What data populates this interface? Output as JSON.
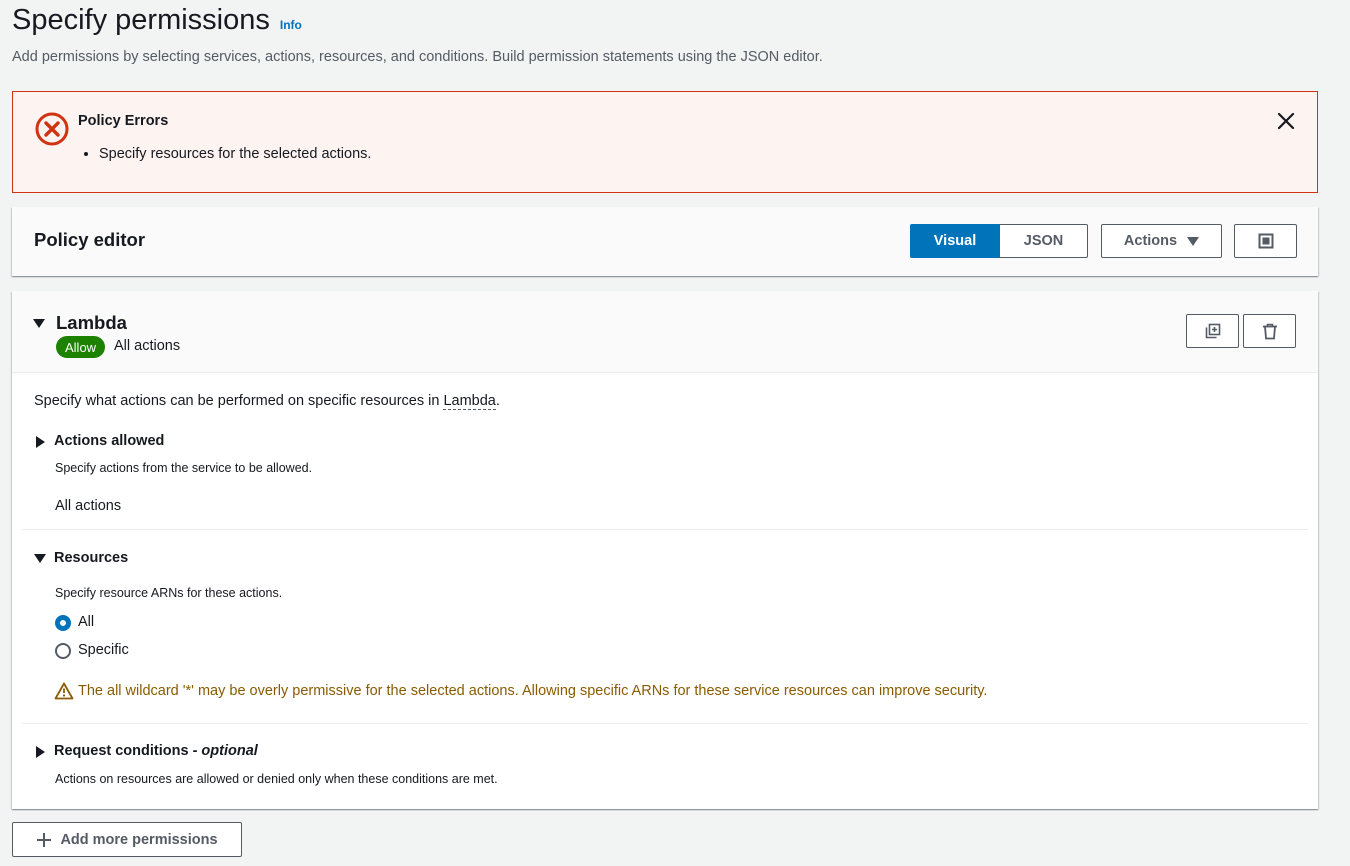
{
  "header": {
    "title": "Specify permissions",
    "info_link": "Info",
    "description": "Add permissions by selecting services, actions, resources, and conditions. Build permission statements using the JSON editor."
  },
  "alert": {
    "title": "Policy Errors",
    "items": [
      "Specify resources for the selected actions."
    ]
  },
  "editor": {
    "title": "Policy editor",
    "tabs": [
      "Visual",
      "JSON"
    ],
    "selected_tab": "Visual",
    "actions_label": "Actions"
  },
  "statement": {
    "service": "Lambda",
    "effect_badge": "Allow",
    "actions_summary": "All actions",
    "intro_prefix": "Specify what actions can be performed on specific resources in ",
    "intro_service": "Lambda",
    "intro_suffix": ".",
    "actions_allowed": {
      "title": "Actions allowed",
      "description": "Specify actions from the service to be allowed.",
      "value": "All actions"
    },
    "resources": {
      "title": "Resources",
      "description": "Specify resource ARNs for these actions.",
      "options": [
        "All",
        "Specific"
      ],
      "selected": "All",
      "warning": "The all wildcard '*' may be overly permissive for the selected actions. Allowing specific ARNs for these service resources can improve security."
    },
    "conditions": {
      "title": "Request conditions",
      "optional": "- optional",
      "description": "Actions on resources are allowed or denied only when these conditions are met."
    }
  },
  "add_button": "Add more permissions",
  "colors": {
    "accent": "#0073bb",
    "error": "#d13212",
    "success": "#1d8102",
    "warning": "#8a5b00"
  }
}
